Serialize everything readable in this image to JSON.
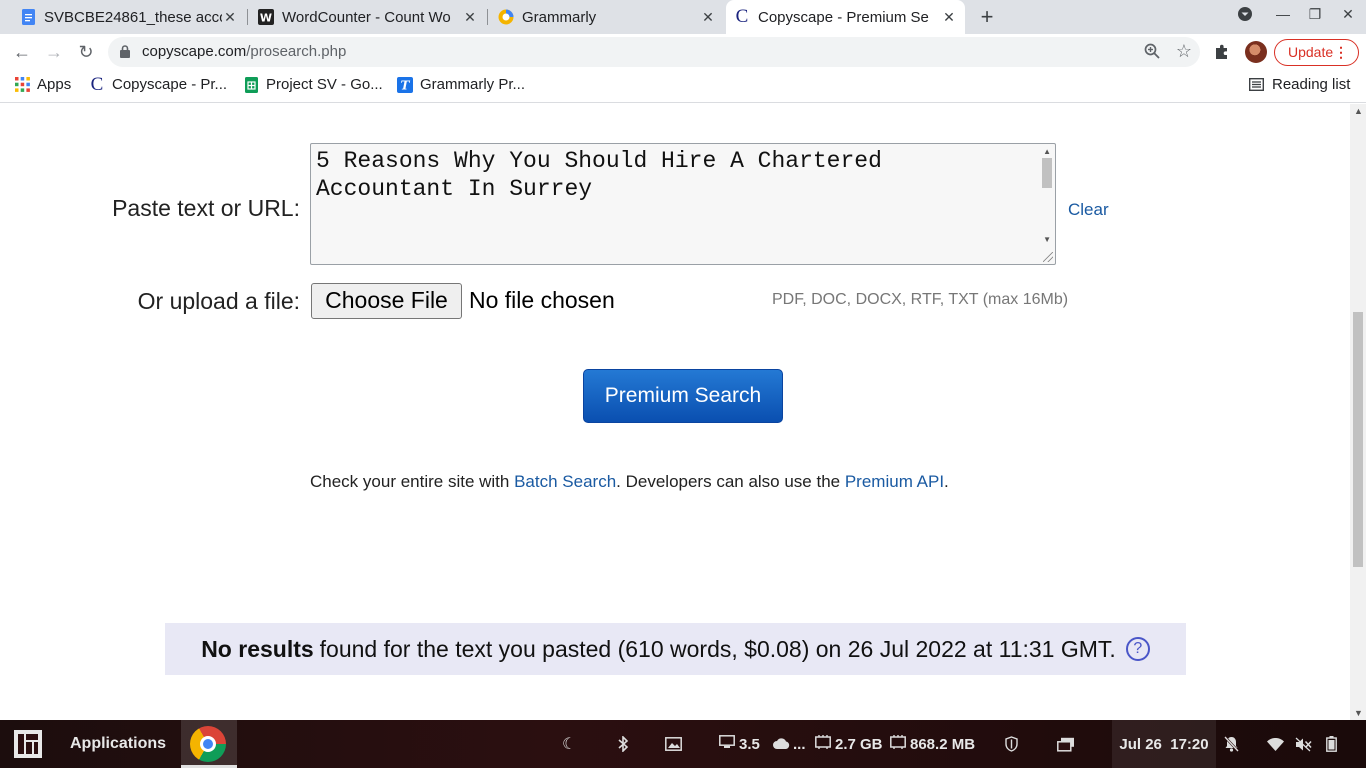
{
  "tabs": [
    {
      "title": "SVBCBE24861_these acco",
      "icon": "docs-icon",
      "active": false
    },
    {
      "title": "WordCounter - Count Wo",
      "icon": "wordcounter-icon",
      "active": false
    },
    {
      "title": "Grammarly",
      "icon": "grammarly-icon",
      "active": false
    },
    {
      "title": "Copyscape - Premium Se",
      "icon": "copyscape-icon",
      "active": true
    }
  ],
  "toolbar": {
    "url_host": "copyscape.com",
    "url_path": "/prosearch.php",
    "update_label": "Update"
  },
  "bookmarks": [
    {
      "label": "Apps",
      "icon": "apps-grid-icon"
    },
    {
      "label": "Copyscape - Pr...",
      "icon": "copyscape-icon"
    },
    {
      "label": "Project SV - Go...",
      "icon": "sheets-icon"
    },
    {
      "label": "Grammarly Pr...",
      "icon": "grammarly-icon"
    }
  ],
  "reading_list": "Reading list",
  "form": {
    "paste_label": "Paste text or URL:",
    "text_value": "5 Reasons Why You Should Hire A Chartered Accountant In Surrey",
    "clear_label": "Clear",
    "upload_label": "Or upload a file:",
    "choose_file": "Choose File",
    "no_file": "No file chosen",
    "formats": "PDF, DOC, DOCX, RTF, TXT (max 16Mb)",
    "search_button": "Premium Search"
  },
  "batch": {
    "prefix": "Check your entire site with ",
    "batch_link": "Batch Search",
    "middle": ". Developers can also use the ",
    "api_link": "Premium API",
    "suffix": "."
  },
  "result": {
    "bold": "No results",
    "text": "found for the text you pasted (610 words, $0.08) on 26 Jul 2022 at 11:31 GMT."
  },
  "taskbar": {
    "applications": "Applications",
    "cpu": "3.5",
    "cloud": "...",
    "disk": "2.7 GB",
    "mem": "868.2 MB",
    "date": "Jul 26",
    "time": "17:20"
  }
}
